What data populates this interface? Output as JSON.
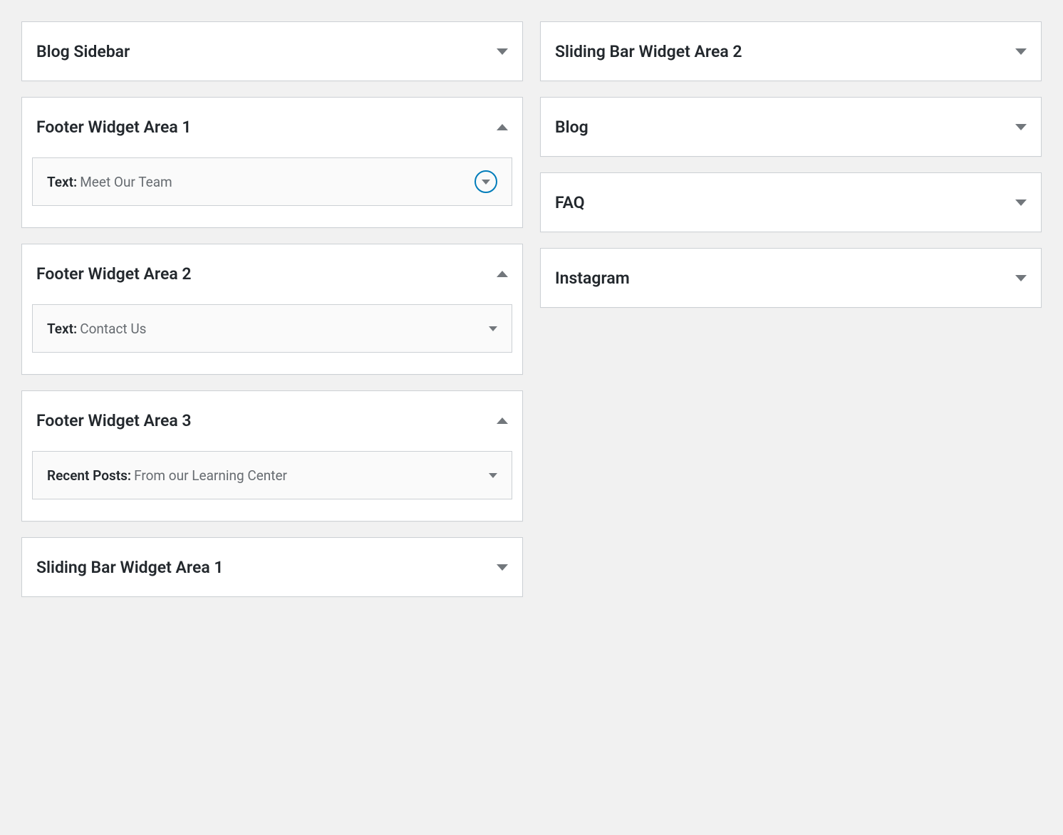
{
  "left": {
    "areas": [
      {
        "title": "Blog Sidebar",
        "open": false,
        "widgets": []
      },
      {
        "title": "Footer Widget Area 1",
        "open": true,
        "widgets": [
          {
            "type": "Text",
            "name": "Meet Our Team",
            "highlighted": true
          }
        ]
      },
      {
        "title": "Footer Widget Area 2",
        "open": true,
        "widgets": [
          {
            "type": "Text",
            "name": "Contact Us",
            "highlighted": false
          }
        ]
      },
      {
        "title": "Footer Widget Area 3",
        "open": true,
        "widgets": [
          {
            "type": "Recent Posts",
            "name": "From our Learning Center",
            "highlighted": false
          }
        ]
      },
      {
        "title": "Sliding Bar Widget Area 1",
        "open": false,
        "widgets": []
      }
    ]
  },
  "right": {
    "areas": [
      {
        "title": "Sliding Bar Widget Area 2",
        "open": false,
        "widgets": []
      },
      {
        "title": "Blog",
        "open": false,
        "widgets": []
      },
      {
        "title": "FAQ",
        "open": false,
        "widgets": []
      },
      {
        "title": "Instagram",
        "open": false,
        "widgets": []
      }
    ]
  }
}
